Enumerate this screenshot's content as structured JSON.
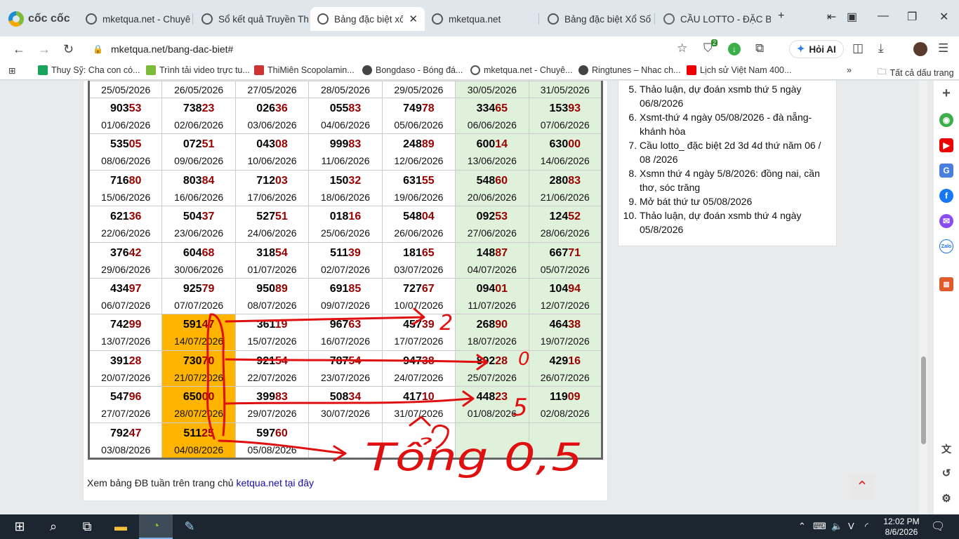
{
  "browser": {
    "brand": "cốc cốc",
    "tabs": [
      {
        "label": "mketqua.net - Chuyê",
        "icon": "mketqua-icon"
      },
      {
        "label": "Sổ kết quả Truyền Th",
        "icon": "mketqua-icon"
      },
      {
        "label": "Bảng đặc biệt xổ",
        "icon": "mketqua-icon",
        "active": true
      },
      {
        "label": "mketqua.net",
        "icon": "mketqua-icon"
      },
      {
        "label": "Bảng đặc biệt Xổ Số",
        "icon": "mketqua-icon"
      },
      {
        "label": "CẦU LOTTO - ĐẶC BI",
        "icon": "globe-icon"
      }
    ],
    "url": "mketqua.net/bang-dac-biet#",
    "ai_button": "Hỏi AI",
    "ext_badge": "2",
    "bookmarks": [
      "Thuy Sỹ: Cha con có...",
      "Trình tải video trực tu...",
      "ThiMiên Scopolamin...",
      "Bongdaso - Bóng đá...",
      "mketqua.net - Chuyê...",
      "Ringtunes – Nhac ch...",
      "Lịch sử Việt Nam 400..."
    ],
    "bookmarks_all": "Tất cả dấu trang"
  },
  "table": {
    "first_row_dates": [
      "25/05/2026",
      "26/05/2026",
      "27/05/2026",
      "28/05/2026",
      "29/05/2026",
      "30/05/2026",
      "31/05/2026"
    ],
    "rows": [
      [
        [
          "903",
          "53",
          "01/06/2026"
        ],
        [
          "738",
          "23",
          "02/06/2026"
        ],
        [
          "026",
          "36",
          "03/06/2026"
        ],
        [
          "055",
          "83",
          "04/06/2026"
        ],
        [
          "749",
          "78",
          "05/06/2026"
        ],
        [
          "334",
          "65",
          "06/06/2026"
        ],
        [
          "153",
          "93",
          "07/06/2026"
        ]
      ],
      [
        [
          "535",
          "05",
          "08/06/2026"
        ],
        [
          "072",
          "51",
          "09/06/2026"
        ],
        [
          "043",
          "08",
          "10/06/2026"
        ],
        [
          "999",
          "83",
          "11/06/2026"
        ],
        [
          "248",
          "89",
          "12/06/2026"
        ],
        [
          "600",
          "14",
          "13/06/2026"
        ],
        [
          "630",
          "00",
          "14/06/2026"
        ]
      ],
      [
        [
          "716",
          "80",
          "15/06/2026"
        ],
        [
          "803",
          "84",
          "16/06/2026"
        ],
        [
          "712",
          "03",
          "17/06/2026"
        ],
        [
          "150",
          "32",
          "18/06/2026"
        ],
        [
          "631",
          "55",
          "19/06/2026"
        ],
        [
          "548",
          "60",
          "20/06/2026"
        ],
        [
          "280",
          "83",
          "21/06/2026"
        ]
      ],
      [
        [
          "621",
          "36",
          "22/06/2026"
        ],
        [
          "504",
          "37",
          "23/06/2026"
        ],
        [
          "527",
          "51",
          "24/06/2026"
        ],
        [
          "018",
          "16",
          "25/06/2026"
        ],
        [
          "548",
          "04",
          "26/06/2026"
        ],
        [
          "092",
          "53",
          "27/06/2026"
        ],
        [
          "124",
          "52",
          "28/06/2026"
        ]
      ],
      [
        [
          "376",
          "42",
          "29/06/2026"
        ],
        [
          "604",
          "68",
          "30/06/2026"
        ],
        [
          "318",
          "54",
          "01/07/2026"
        ],
        [
          "511",
          "39",
          "02/07/2026"
        ],
        [
          "181",
          "65",
          "03/07/2026"
        ],
        [
          "148",
          "87",
          "04/07/2026"
        ],
        [
          "667",
          "71",
          "05/07/2026"
        ]
      ],
      [
        [
          "434",
          "97",
          "06/07/2026"
        ],
        [
          "925",
          "79",
          "07/07/2026"
        ],
        [
          "950",
          "89",
          "08/07/2026"
        ],
        [
          "691",
          "85",
          "09/07/2026"
        ],
        [
          "727",
          "67",
          "10/07/2026"
        ],
        [
          "094",
          "01",
          "11/07/2026"
        ],
        [
          "104",
          "94",
          "12/07/2026"
        ]
      ],
      [
        [
          "742",
          "99",
          "13/07/2026"
        ],
        [
          "591",
          "47",
          "14/07/2026"
        ],
        [
          "361",
          "19",
          "15/07/2026"
        ],
        [
          "967",
          "63",
          "16/07/2026"
        ],
        [
          "457",
          "39",
          "17/07/2026"
        ],
        [
          "268",
          "90",
          "18/07/2026"
        ],
        [
          "464",
          "38",
          "19/07/2026"
        ]
      ],
      [
        [
          "391",
          "28",
          "20/07/2026"
        ],
        [
          "730",
          "70",
          "21/07/2026"
        ],
        [
          "921",
          "54",
          "22/07/2026"
        ],
        [
          "787",
          "54",
          "23/07/2026"
        ],
        [
          "947",
          "38",
          "24/07/2026"
        ],
        [
          "892",
          "28",
          "25/07/2026"
        ],
        [
          "429",
          "16",
          "26/07/2026"
        ]
      ],
      [
        [
          "547",
          "96",
          "27/07/2026"
        ],
        [
          "650",
          "00",
          "28/07/2026"
        ],
        [
          "399",
          "83",
          "29/07/2026"
        ],
        [
          "508",
          "34",
          "30/07/2026"
        ],
        [
          "417",
          "10",
          "31/07/2026"
        ],
        [
          "448",
          "23",
          "01/08/2026"
        ],
        [
          "119",
          "09",
          "02/08/2026"
        ]
      ],
      [
        [
          "792",
          "47",
          "03/08/2026"
        ],
        [
          "511",
          "25",
          "04/08/2026"
        ],
        [
          "597",
          "60",
          "05/08/2026"
        ],
        [
          "",
          "",
          ""
        ],
        [
          "",
          "",
          ""
        ],
        [
          "",
          "",
          ""
        ],
        [
          "",
          "",
          ""
        ]
      ]
    ],
    "highlight_col": 1,
    "highlight_from_row": 6
  },
  "footer": {
    "text": "Xem bảng ĐB tuần trên trang chủ ",
    "link": "ketqua.net tại đây"
  },
  "sidebar": {
    "items": [
      "Thảo luận, dự đoán xsmb thứ 5 ngày 06/8/2026",
      "Xsmt-thứ 4 ngày 05/08/2026 - đà nẵng-khánh hòa",
      "Cầu lotto_ đặc biệt 2d 3d 4d thứ năm 06 / 08 /2026",
      "Xsmn thứ 4 ngày 5/8/2026: đồng nai, cần thơ, sóc trăng",
      "Mở bát thứ tư 05/08/2026",
      "Thảo luận, dự đoán xsmb thứ 4 ngày 05/8/2026"
    ],
    "start": 5
  },
  "annotations": {
    "n1": "2",
    "n2": "0",
    "n3": "5",
    "note": "Tổng 0,5"
  },
  "taskbar": {
    "time": "12:02 PM",
    "date": "8/6/2026"
  },
  "colors": {
    "weekend": "#dff1db",
    "highlight": "#ffb400",
    "tail": "#990000",
    "ink": "#e01010"
  }
}
